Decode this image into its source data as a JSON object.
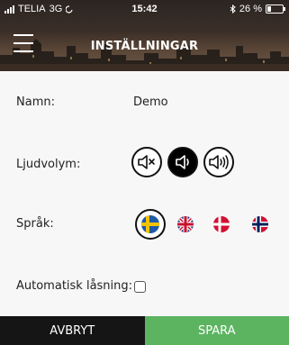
{
  "status_bar": {
    "carrier": "TELIA",
    "network": "3G",
    "time": "15:42",
    "battery": "26 %",
    "battery_level": 0.26
  },
  "header": {
    "title": "INSTÄLLNINGAR"
  },
  "settings": {
    "name": {
      "label": "Namn:",
      "value": "Demo"
    },
    "volume": {
      "label": "Ljudvolym:",
      "options": [
        "mute-icon",
        "volume-low-icon",
        "volume-high-icon"
      ],
      "selected": 1
    },
    "language": {
      "label": "Språk:",
      "options": [
        "flag-sweden-icon",
        "flag-uk-icon",
        "flag-denmark-icon",
        "flag-norway-icon"
      ],
      "selected": 0
    },
    "auto_lock": {
      "label": "Automatisk låsning:",
      "checked": false
    }
  },
  "actions": {
    "cancel_label": "AVBRYT",
    "save_label": "SPARA"
  },
  "colors": {
    "save": "#5cb460",
    "cancel": "#151515"
  }
}
